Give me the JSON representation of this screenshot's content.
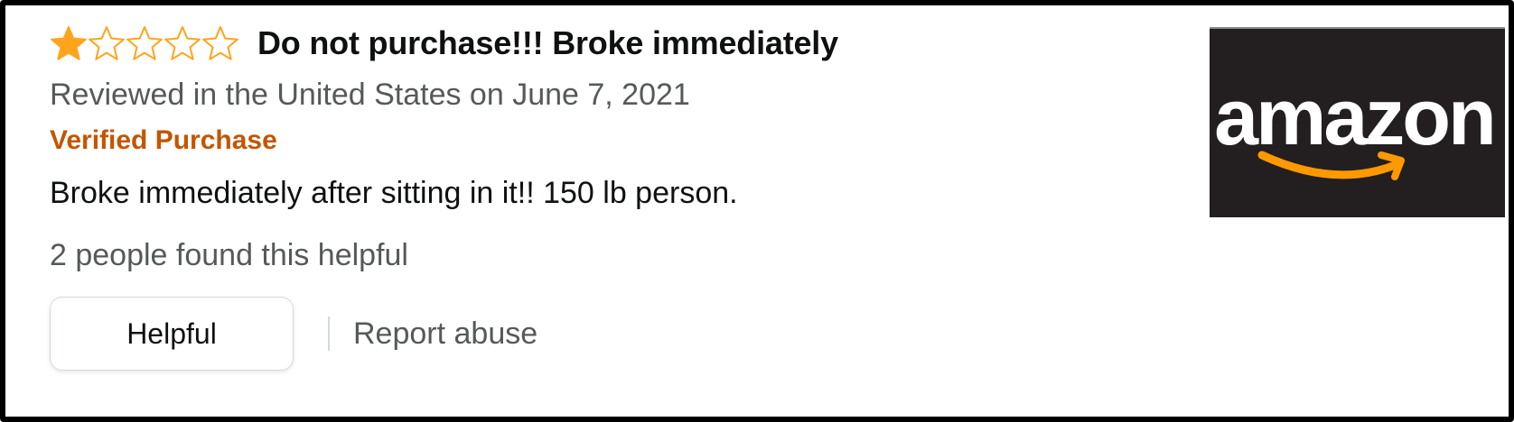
{
  "review": {
    "rating": 1,
    "max_rating": 5,
    "star_icon_names": [
      "star-filled-icon",
      "star-empty-icon"
    ],
    "title": "Do not purchase!!! Broke immediately",
    "meta": "Reviewed in the United States on June 7, 2021",
    "verified_label": "Verified Purchase",
    "body": "Broke immediately after sitting in it!! 150 lb person.",
    "helpful_count_text": "2 people found this helpful",
    "helpful_button_label": "Helpful",
    "report_label": "Report abuse"
  },
  "logo": {
    "wordmark": "amazon",
    "background": "#231f20",
    "text_color": "#ffffff",
    "smile_color": "#ff9900"
  },
  "colors": {
    "star": "#ffa41c",
    "verified": "#c45500",
    "meta": "#565959",
    "text": "#0f1111"
  }
}
